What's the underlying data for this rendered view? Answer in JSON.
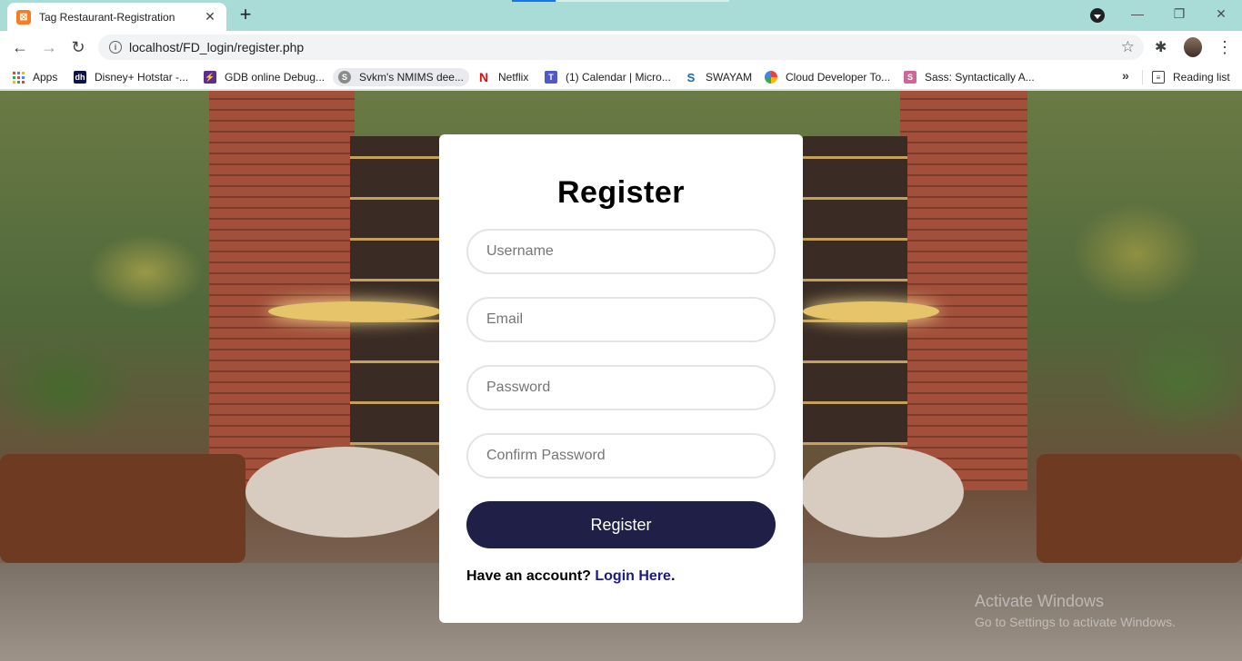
{
  "browser": {
    "tab_title": "Tag Restaurant-Registration",
    "tab_favicon": "xampp-icon",
    "new_tab": "+",
    "url": "localhost/FD_login/register.php"
  },
  "bookmarks": {
    "items": [
      {
        "label": "Apps",
        "icon": "apps-grid-icon"
      },
      {
        "label": "Disney+ Hotstar -...",
        "icon": "hotstar-icon"
      },
      {
        "label": "GDB online Debug...",
        "icon": "gdb-icon"
      },
      {
        "label": "Svkm's NMIMS dee...",
        "icon": "nmims-icon"
      },
      {
        "label": "Netflix",
        "icon": "netflix-icon"
      },
      {
        "label": "(1) Calendar | Micro...",
        "icon": "teams-icon"
      },
      {
        "label": "SWAYAM",
        "icon": "swayam-icon"
      },
      {
        "label": "Cloud Developer To...",
        "icon": "google-cloud-icon"
      },
      {
        "label": "Sass: Syntactically A...",
        "icon": "sass-icon"
      }
    ],
    "overflow": "»",
    "reading_list": "Reading list"
  },
  "form": {
    "title": "Register",
    "username_placeholder": "Username",
    "email_placeholder": "Email",
    "password_placeholder": "Password",
    "confirm_placeholder": "Confirm Password",
    "submit_label": "Register",
    "have_account": "Have an account? ",
    "login_link": "Login Here",
    "login_period": "."
  },
  "watermark": {
    "line1": "Activate Windows",
    "line2": "Go to Settings to activate Windows."
  },
  "colors": {
    "tabstrip": "#a9dcd6",
    "button": "#1f1f47",
    "link": "#1a1a8c"
  }
}
